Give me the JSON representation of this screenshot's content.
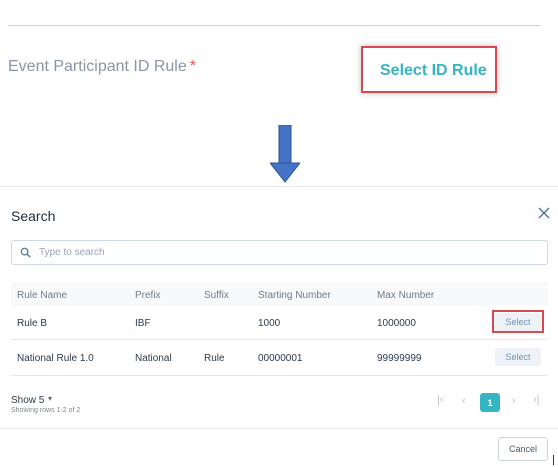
{
  "field": {
    "label": "Event Participant ID Rule",
    "required_mark": "*",
    "action_label": "Select ID Rule"
  },
  "modal": {
    "title": "Search",
    "search": {
      "placeholder": "Type to search",
      "value": ""
    },
    "columns": [
      "Rule Name",
      "Prefix",
      "Suffix",
      "Starting Number",
      "Max Number"
    ],
    "rows": [
      {
        "rule_name": "Rule B",
        "prefix": "IBF",
        "suffix": "",
        "starting_number": "1000",
        "max_number": "1000000",
        "action": "Select"
      },
      {
        "rule_name": "National Rule 1.0",
        "prefix": "National",
        "suffix": "Rule",
        "starting_number": "00000001",
        "max_number": "99999999",
        "action": "Select"
      }
    ],
    "footer": {
      "show_label": "Show 5",
      "rows_info": "Showing rows 1-2 of 2",
      "pagination": {
        "current_page": "1"
      },
      "cancel_label": "Cancel"
    }
  },
  "colors": {
    "accent": "#35b5c4",
    "highlight": "#d9484e",
    "arrow": "#4472c4"
  },
  "icons": [
    "down-arrow-icon",
    "close-icon",
    "search-icon",
    "caret-down-icon",
    "first-page-icon",
    "prev-page-icon",
    "next-page-icon",
    "last-page-icon"
  ]
}
